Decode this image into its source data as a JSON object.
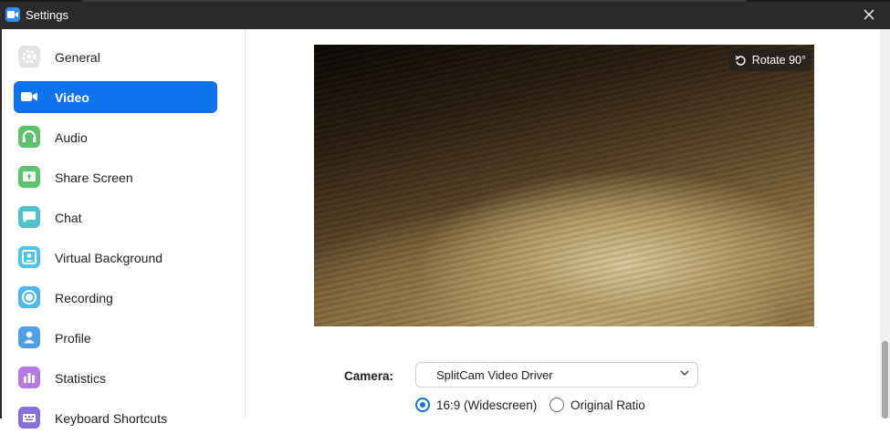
{
  "window": {
    "title": "Settings"
  },
  "sidebar": {
    "items": [
      {
        "label": "General",
        "icon": "gear-icon",
        "color": "#e0e0e0",
        "active": false
      },
      {
        "label": "Video",
        "icon": "video-camera-icon",
        "color": "#ffffff",
        "active": true
      },
      {
        "label": "Audio",
        "icon": "headphones-icon",
        "color": "#5cc26b",
        "active": false
      },
      {
        "label": "Share Screen",
        "icon": "share-screen-icon",
        "color": "#5cc26b",
        "active": false
      },
      {
        "label": "Chat",
        "icon": "chat-bubble-icon",
        "color": "#4fc3c9",
        "active": false
      },
      {
        "label": "Virtual Background",
        "icon": "portrait-icon",
        "color": "#4fc3e6",
        "active": false
      },
      {
        "label": "Recording",
        "icon": "record-icon",
        "color": "#4fb8e6",
        "active": false
      },
      {
        "label": "Profile",
        "icon": "person-icon",
        "color": "#4f9ee6",
        "active": false
      },
      {
        "label": "Statistics",
        "icon": "bar-chart-icon",
        "color": "#b57be0",
        "active": false
      },
      {
        "label": "Keyboard Shortcuts",
        "icon": "keyboard-icon",
        "color": "#8a6fd9",
        "active": false
      }
    ]
  },
  "preview": {
    "rotate_label": "Rotate 90°"
  },
  "camera": {
    "label": "Camera:",
    "selected": "SplitCam Video Driver",
    "ratio_options": [
      {
        "label": "16:9 (Widescreen)",
        "selected": true
      },
      {
        "label": "Original Ratio",
        "selected": false
      }
    ]
  },
  "colors": {
    "accent": "#0E72ED",
    "titlebar": "#2b2b2b"
  }
}
